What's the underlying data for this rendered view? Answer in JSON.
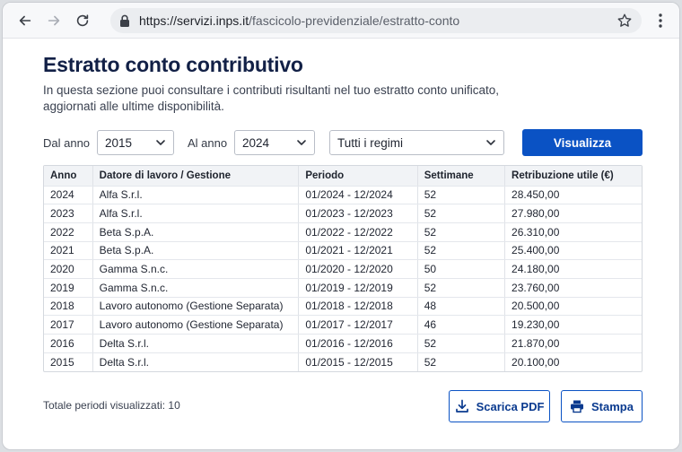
{
  "browser": {
    "url_host": "https://servizi.inps.it",
    "url_path": "/fascicolo-previdenziale/estratto-conto",
    "icons": [
      "back-icon",
      "forward-icon",
      "reload-icon",
      "lock-icon",
      "star-icon",
      "kebab-menu-icon"
    ]
  },
  "page": {
    "title": "Estratto conto contributivo",
    "description": "In questa sezione puoi consultare i contributi risultanti nel tuo estratto conto unificato, aggiornati alle ultime disponibilità."
  },
  "filters": {
    "from_label": "Dal anno",
    "from_value": "2015",
    "to_label": "Al anno",
    "to_value": "2024",
    "regime_value": "Tutti i regimi",
    "submit_label": "Visualizza"
  },
  "table": {
    "headers": [
      "Anno",
      "Datore di lavoro / Gestione",
      "Periodo",
      "Settimane",
      "Retribuzione utile (€)"
    ],
    "rows": [
      [
        "2024",
        "Alfa S.r.l.",
        "01/2024 - 12/2024",
        "52",
        "28.450,00"
      ],
      [
        "2023",
        "Alfa S.r.l.",
        "01/2023 - 12/2023",
        "52",
        "27.980,00"
      ],
      [
        "2022",
        "Beta S.p.A.",
        "01/2022 - 12/2022",
        "52",
        "26.310,00"
      ],
      [
        "2021",
        "Beta S.p.A.",
        "01/2021 - 12/2021",
        "52",
        "25.400,00"
      ],
      [
        "2020",
        "Gamma S.n.c.",
        "01/2020 - 12/2020",
        "50",
        "24.180,00"
      ],
      [
        "2019",
        "Gamma S.n.c.",
        "01/2019 - 12/2019",
        "52",
        "23.760,00"
      ],
      [
        "2018",
        "Lavoro autonomo (Gestione Separata)",
        "01/2018 - 12/2018",
        "48",
        "20.500,00"
      ],
      [
        "2017",
        "Lavoro autonomo (Gestione Separata)",
        "01/2017 - 12/2017",
        "46",
        "19.230,00"
      ],
      [
        "2016",
        "Delta S.r.l.",
        "01/2016 - 12/2016",
        "52",
        "21.870,00"
      ],
      [
        "2015",
        "Delta S.r.l.",
        "01/2015 - 12/2015",
        "52",
        "20.100,00"
      ]
    ]
  },
  "footer": {
    "total_text": "Totale periodi visualizzati: 10",
    "pdf_label": "Scarica PDF",
    "print_label": "Stampa"
  },
  "colors": {
    "primary": "#0a52c4",
    "title": "#122046"
  }
}
